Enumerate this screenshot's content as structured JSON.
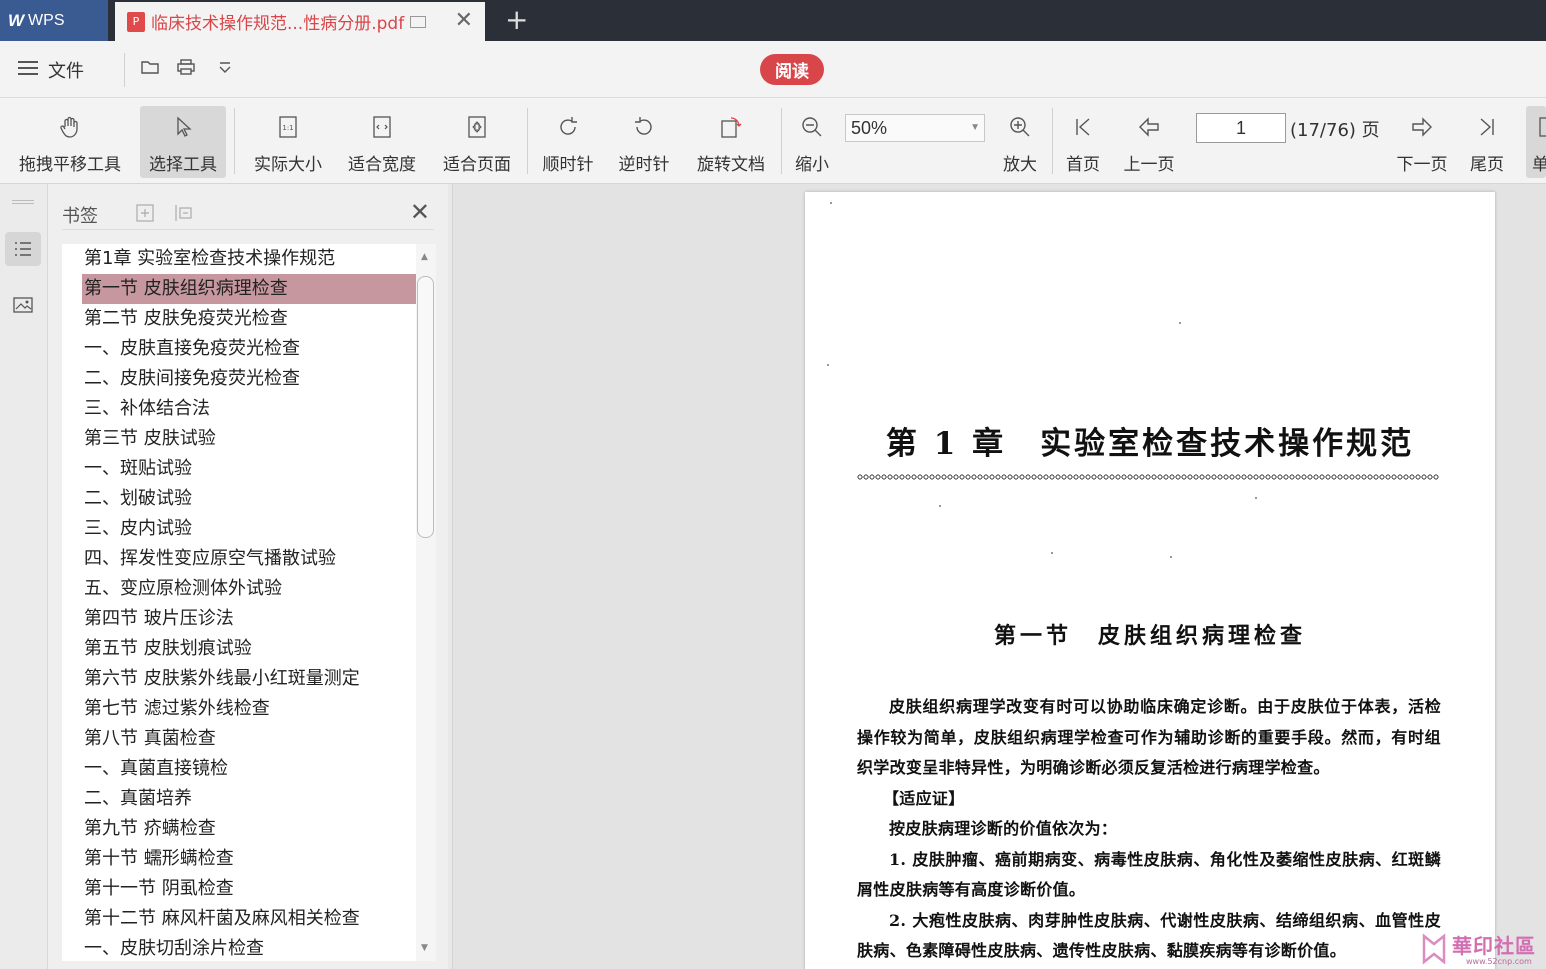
{
  "titlebar": {
    "app_tab": "WPS",
    "doc_tab": "临床技术操作规范...性病分册.pdf",
    "pdf_badge": "P",
    "new_tab": "+",
    "close": "✕"
  },
  "menubar": {
    "file_label": "文件",
    "read_label": "阅读"
  },
  "toolbar": {
    "tools": [
      {
        "id": "pan",
        "label": "拖拽平移工具"
      },
      {
        "id": "select",
        "label": "选择工具"
      },
      {
        "id": "actual",
        "label": "实际大小"
      },
      {
        "id": "fitwidth",
        "label": "适合宽度"
      },
      {
        "id": "fitpage",
        "label": "适合页面"
      },
      {
        "id": "cw",
        "label": "顺时针"
      },
      {
        "id": "ccw",
        "label": "逆时针"
      },
      {
        "id": "rotate",
        "label": "旋转文档"
      },
      {
        "id": "zoomout",
        "label": "缩小"
      },
      {
        "id": "zoomin",
        "label": "放大"
      },
      {
        "id": "first",
        "label": "首页"
      },
      {
        "id": "prev",
        "label": "上一页"
      },
      {
        "id": "next",
        "label": "下一页"
      },
      {
        "id": "last",
        "label": "尾页"
      },
      {
        "id": "single",
        "label": "单"
      }
    ],
    "zoom_value": "50%",
    "page_value": "1",
    "page_count": "(17/76) 页"
  },
  "bookmarks": {
    "title": "书签",
    "close": "✕",
    "items": [
      "第1章 实验室检查技术操作规范",
      "第一节 皮肤组织病理检查",
      "第二节 皮肤免疫荧光检查",
      "一、皮肤直接免疫荧光检查",
      "二、皮肤间接免疫荧光检查",
      "三、补体结合法",
      "第三节 皮肤试验",
      "一、斑贴试验",
      "二、划破试验",
      "三、皮内试验",
      "四、挥发性变应原空气播散试验",
      "五、变应原检测体外试验",
      "第四节 玻片压诊法",
      "第五节 皮肤划痕试验",
      "第六节 皮肤紫外线最小红斑量测定",
      "第七节 滤过紫外线检查",
      "第八节 真菌检查",
      "一、真菌直接镜检",
      "二、真菌培养",
      "第九节 疥螨检查",
      "第十节 蠕形螨检查",
      "第十一节 阴虱检查",
      "第十二节 麻风杆菌及麻风相关检查",
      "一、皮肤切刮涂片检查"
    ],
    "selected_index": 1
  },
  "document": {
    "chapter_title": "第 1 章　实验室检查技术操作规范",
    "section_title": "第一节　皮肤组织病理检查",
    "p1": "皮肤组织病理学改变有时可以协助临床确定诊断。由于皮肤位于体表，活检操作较为简单，皮肤组织病理学检查可作为辅助诊断的重要手段。然而，有时组织学改变呈非特异性，为明确诊断必须反复活检进行病理学检查。",
    "p2": "【适应证】",
    "p3": "按皮肤病理诊断的价值依次为：",
    "p4": "1. 皮肤肿瘤、癌前期病变、病毒性皮肤病、角化性及萎缩性皮肤病、红斑鳞屑性皮肤病等有高度诊断价值。",
    "p5": "2. 大疱性皮肤病、肉芽肿性皮肤病、代谢性皮肤病、结缔组织病、血管性皮肤病、色素障碍性皮肤病、遗传性皮肤病、黏膜疾病等有诊断价值。"
  },
  "watermark": {
    "text": "華印社區",
    "url": "www.52cnp.com"
  }
}
